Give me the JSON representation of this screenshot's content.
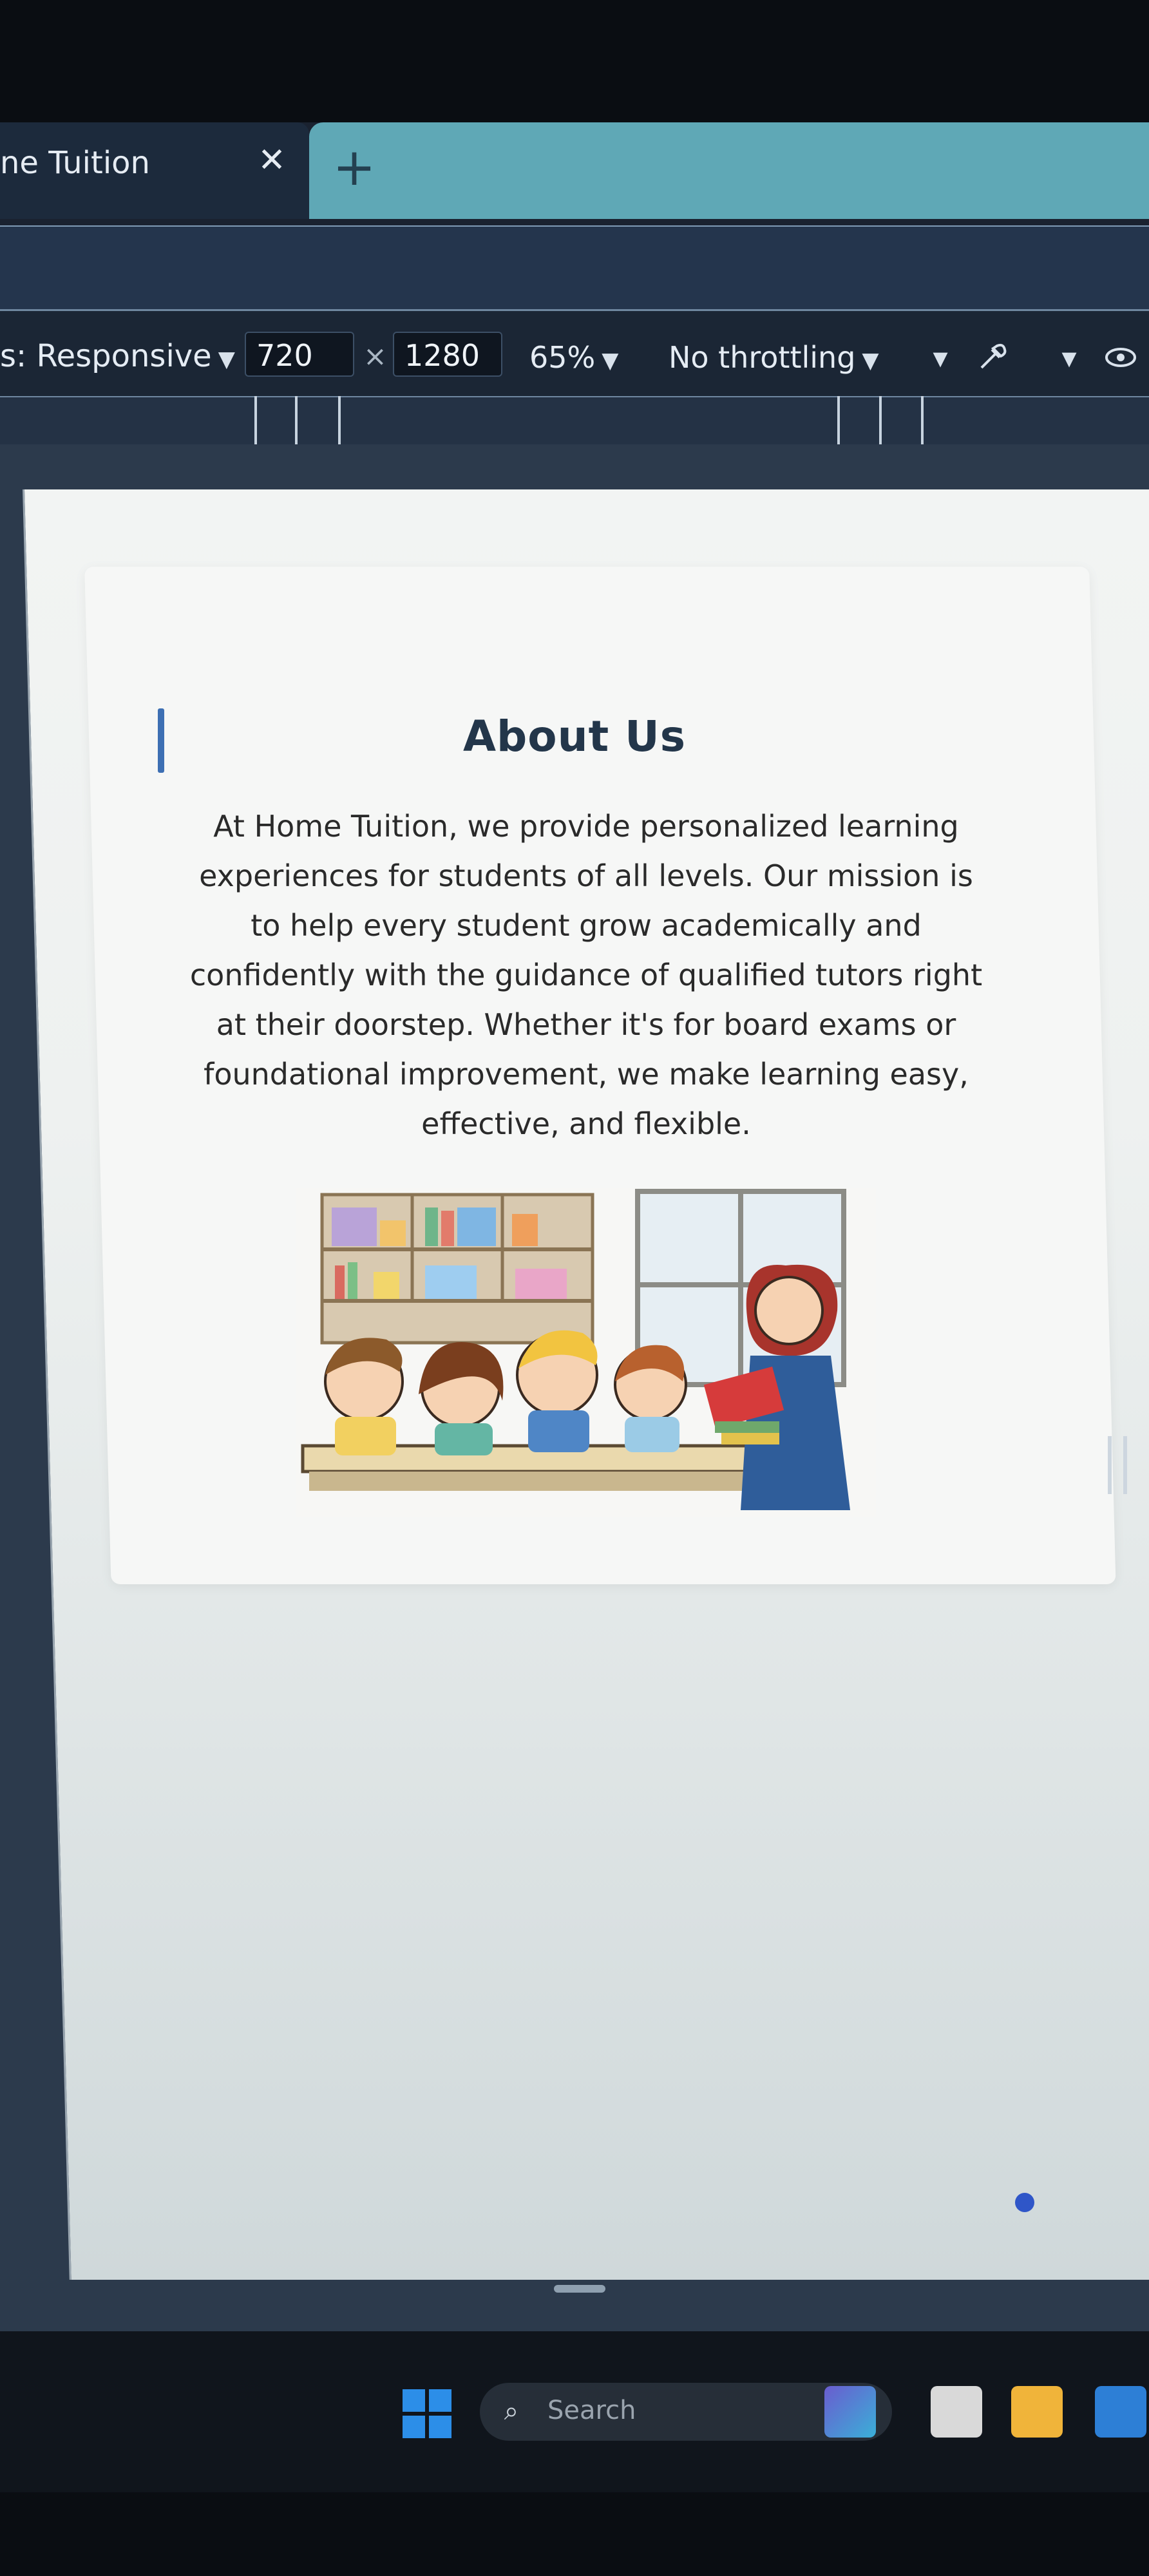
{
  "browser": {
    "tab_title": "ne Tuition",
    "close_glyph": "✕",
    "new_tab_glyph": "+"
  },
  "devtools": {
    "device_label": "s: Responsive",
    "width_value": "720",
    "height_value": "1280",
    "times_glyph": "×",
    "zoom_label": "65%",
    "throttle_label": "No throttling",
    "icons": [
      "chevron-down-icon",
      "eyedropper-icon",
      "chevron-down-icon",
      "eye-icon"
    ]
  },
  "page": {
    "about": {
      "title": "About Us",
      "body": "At Home Tuition, we provide personalized learning experiences for students of all levels. Our mission is to help every student grow academically and confidently with the guidance of qualified tutors right at their doorstep. Whether it's for board exams or foundational improvement, we make learning easy, effective, and flexible.",
      "image": "classroom-illustration",
      "accent_color": "#3d6fb3",
      "title_color": "#23364a"
    }
  },
  "taskbar": {
    "search_placeholder": "Search",
    "apps": [
      "windows-start-icon",
      "search-icon",
      "copilot-app-icon",
      "notes-app-icon",
      "folder-app-icon",
      "mail-app-icon"
    ]
  }
}
